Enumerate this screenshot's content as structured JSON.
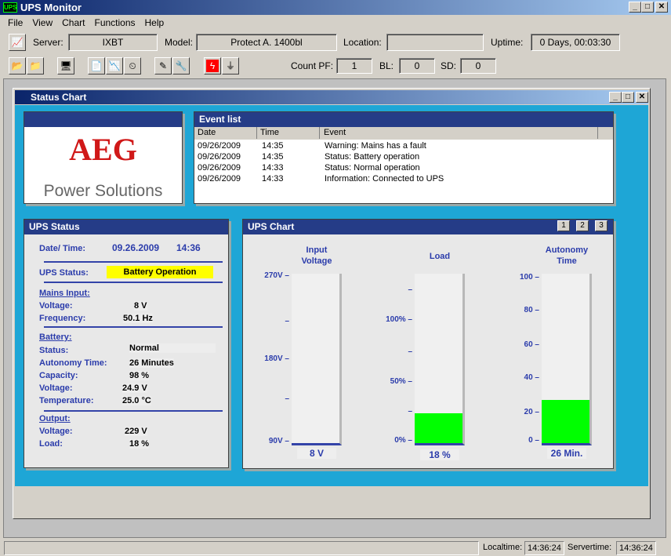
{
  "window": {
    "title": "UPS Monitor"
  },
  "menu": [
    "File",
    "View",
    "Chart",
    "Functions",
    "Help"
  ],
  "info": {
    "server_label": "Server:",
    "server": "IXBT",
    "model_label": "Model:",
    "model": "Protect A.  1400bl",
    "location_label": "Location:",
    "location": "",
    "uptime_label": "Uptime:",
    "uptime": "0 Days, 00:03:30"
  },
  "counts": {
    "pf_label": "Count PF:",
    "pf": "1",
    "bl_label": "BL:",
    "bl": "0",
    "sd_label": "SD:",
    "sd": "0"
  },
  "toolbar_icons": [
    "open-folder-icon",
    "open-file-icon",
    "monitor-icon",
    "report-icon",
    "chart-report-icon",
    "clock-icon",
    "edit-icon",
    "tools-icon",
    "power-fault-icon",
    "plug-icon"
  ],
  "child": {
    "title": "Status Chart"
  },
  "logo": {
    "brand": "AEG",
    "sub": "Power Solutions"
  },
  "events": {
    "title": "Event list",
    "columns": [
      "Date",
      "Time",
      "Event"
    ],
    "rows": [
      [
        "09/26/2009",
        "14:35",
        "Warning: Mains has a fault"
      ],
      [
        "09/26/2009",
        "14:35",
        "Status: Battery operation"
      ],
      [
        "09/26/2009",
        "14:33",
        "Status: Normal operation"
      ],
      [
        "09/26/2009",
        "14:33",
        "Information: Connected to UPS"
      ]
    ]
  },
  "status": {
    "title": "UPS Status",
    "datetime_label": "Date/ Time:",
    "date": "09.26.2009",
    "time": "14:36",
    "ups_status_label": "UPS Status:",
    "ups_status": "Battery Operation",
    "status_color": "#ffff00",
    "mains_title": "Mains Input:",
    "mains_voltage_label": "Voltage:",
    "mains_voltage": "8 V",
    "frequency_label": "Frequency:",
    "frequency": "50.1 Hz",
    "battery_title": "Battery:",
    "bstatus_label": "Status:",
    "bstatus": "Normal",
    "autonomy_label": "Autonomy Time:",
    "autonomy": "26 Minutes",
    "capacity_label": "Capacity:",
    "capacity": "98 %",
    "bvoltage_label": "Voltage:",
    "bvoltage": "24.9 V",
    "temp_label": "Temperature:",
    "temp": "25.0 °C",
    "output_title": "Output:",
    "ovoltage_label": "Voltage:",
    "ovoltage": "229 V",
    "load_label": "Load:",
    "load": "18 %"
  },
  "chart": {
    "title": "UPS Chart",
    "buttons": [
      "1",
      "2",
      "3"
    ],
    "fill_color": "#00ff00",
    "gauges": [
      {
        "title1": "Input",
        "title2": "Voltage",
        "ticks": [
          "270V –",
          "–",
          "180V –",
          "–",
          "90V –"
        ],
        "value": 8,
        "min": 90,
        "max": 270,
        "readout": "8 V"
      },
      {
        "title1": "",
        "title2": "Load",
        "ticks": [
          "–",
          "100% –",
          "–",
          "50% –",
          "–",
          "0% –"
        ],
        "value": 18,
        "min": 0,
        "max": 100,
        "readout": "18 %"
      },
      {
        "title1": "Autonomy",
        "title2": "Time",
        "ticks": [
          "100 –",
          "80 –",
          "60 –",
          "40 –",
          "20 –",
          "0 –"
        ],
        "value": 26,
        "min": 0,
        "max": 100,
        "readout": "26 Min."
      }
    ]
  },
  "statusbar": {
    "localtime_label": "Localtime:",
    "localtime": "14:36:24",
    "servertime_label": "Servertime:",
    "servertime": "14:36:24"
  }
}
